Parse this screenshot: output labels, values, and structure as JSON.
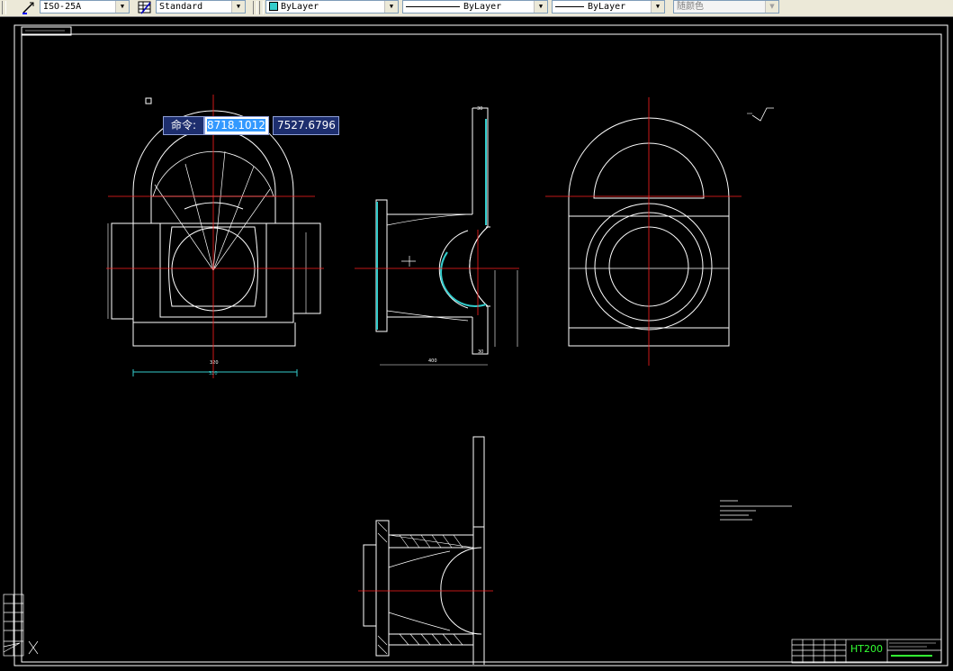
{
  "toolbar": {
    "dim_style": "ISO-25A",
    "table_style": "Standard",
    "color": "ByLayer",
    "linetype": "ByLayer",
    "lineweight": "ByLayer",
    "plot_style": "随颜色"
  },
  "command": {
    "prompt": "命令:",
    "x": "8718.1012",
    "y": "7527.6796"
  },
  "title_block": {
    "material": "HT200"
  },
  "colors": {
    "background": "#000000",
    "lines": "#ffffff",
    "centerline": "#ff2020",
    "section_fill": "#33cccc",
    "highlight": "#3399ff",
    "prompt_bg": "#1d2e6e"
  }
}
